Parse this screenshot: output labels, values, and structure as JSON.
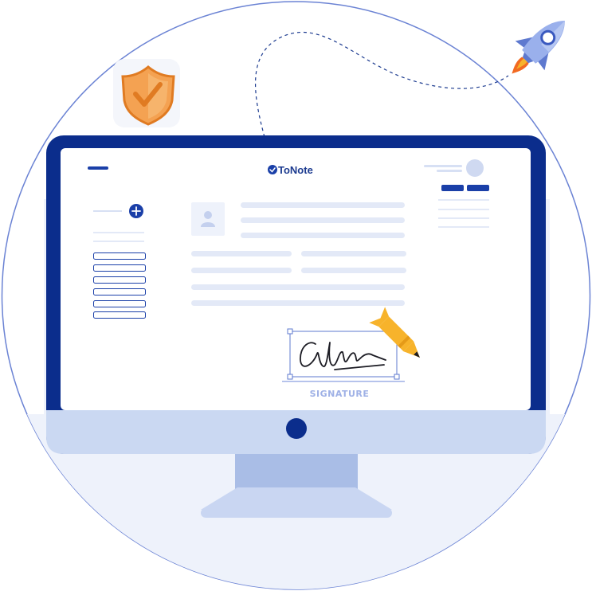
{
  "app": {
    "brand_name": "ToNote"
  },
  "signature": {
    "caption": "SIGNATURE"
  },
  "colors": {
    "navy": "#0b2d8c",
    "accent_blue": "#1a3fa8",
    "light_bg": "#eef2fb",
    "placeholder": "#e3e9f7",
    "stand": "#a9bde6",
    "shield_orange": "#f08c35",
    "pen_yellow": "#f7b32b",
    "rocket_blue": "#8fa6e6",
    "flame": "#f26a21"
  },
  "icons": {
    "shield": "shield-check-icon",
    "rocket": "rocket-icon",
    "menu": "menu-icon",
    "add": "plus-circle-icon",
    "avatar": "user-avatar-icon",
    "pen": "pen-icon",
    "power": "power-button-icon"
  }
}
